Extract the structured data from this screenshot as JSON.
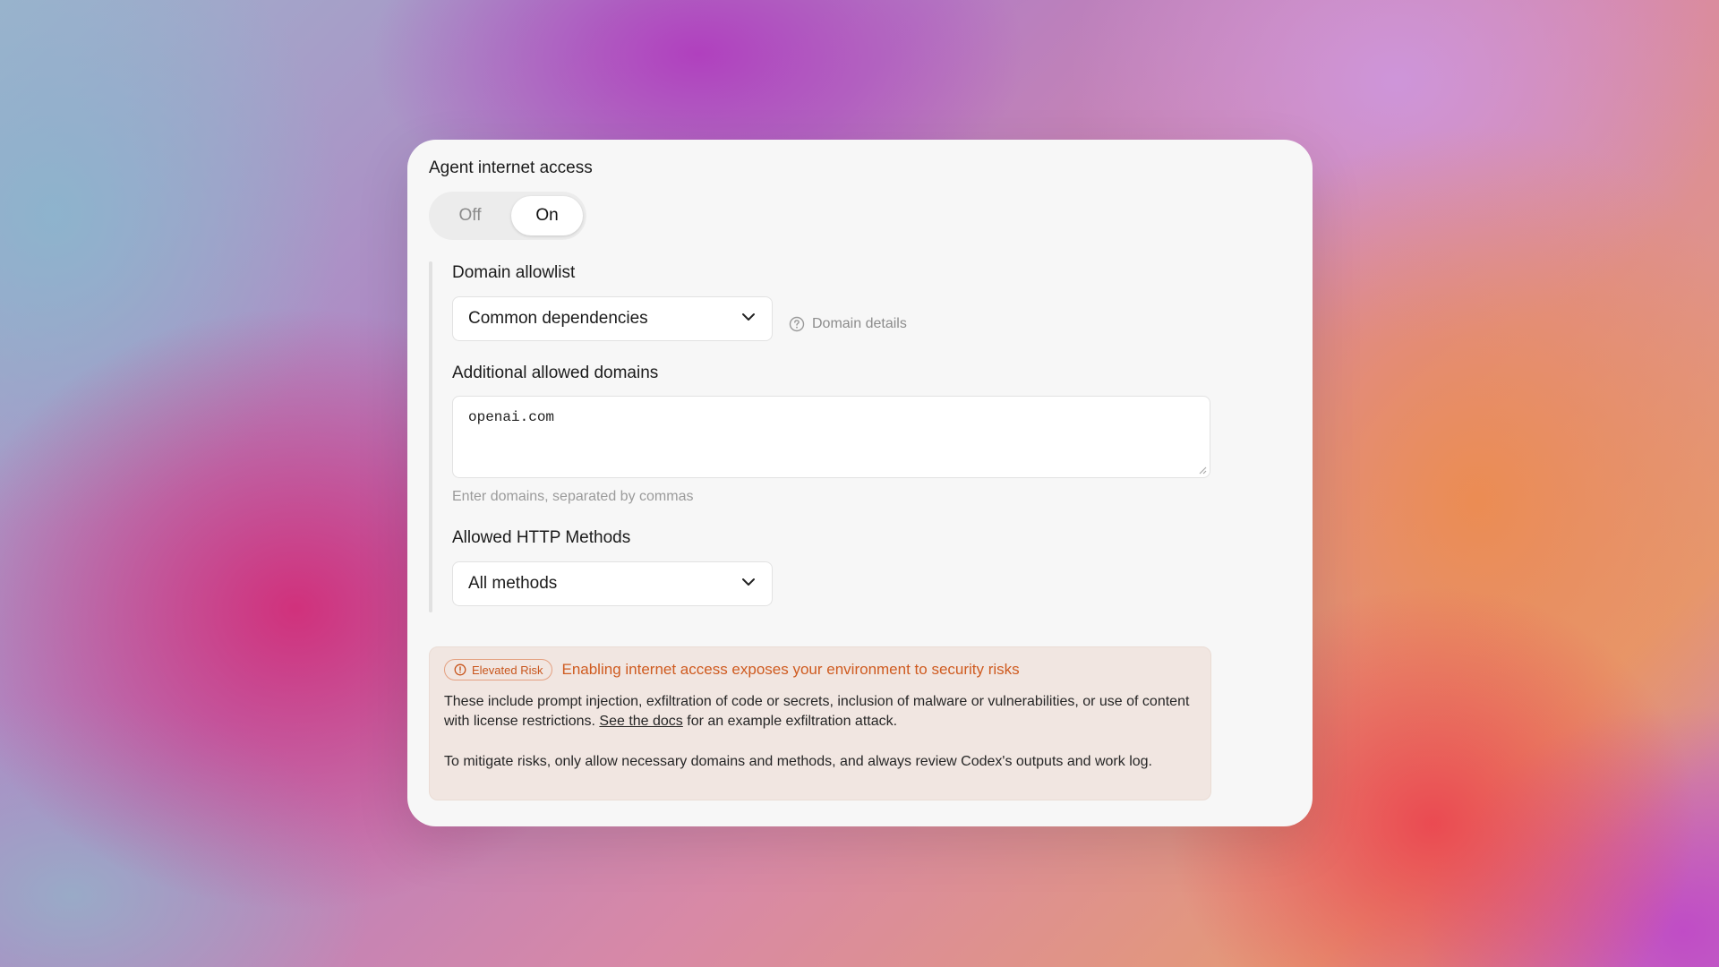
{
  "agent_access": {
    "title": "Agent internet access",
    "toggle_off": "Off",
    "toggle_on": "On",
    "selected": "On"
  },
  "domain_allowlist": {
    "label": "Domain allowlist",
    "selected": "Common dependencies",
    "details_link": "Domain details",
    "details_icon": "help-circle-icon"
  },
  "additional_domains": {
    "label": "Additional allowed domains",
    "value": "openai.com",
    "hint": "Enter domains, separated by commas"
  },
  "http_methods": {
    "label": "Allowed HTTP Methods",
    "selected": "All methods"
  },
  "risk": {
    "badge": "Elevated Risk",
    "badge_icon": "alert-circle-icon",
    "headline": "Enabling internet access exposes your environment to security risks",
    "p1_before": "These include prompt injection, exfiltration of code or secrets, inclusion of malware or vulnerabilities, or use of content with license restrictions.",
    "p1_link": "See the docs",
    "p1_after": "for an example exfiltration attack.",
    "p2": "To mitigate risks, only allow necessary domains and methods, and always review Codex's outputs and work log.",
    "accent_color": "#cf5b20",
    "background_color": "#f1e6e1"
  }
}
